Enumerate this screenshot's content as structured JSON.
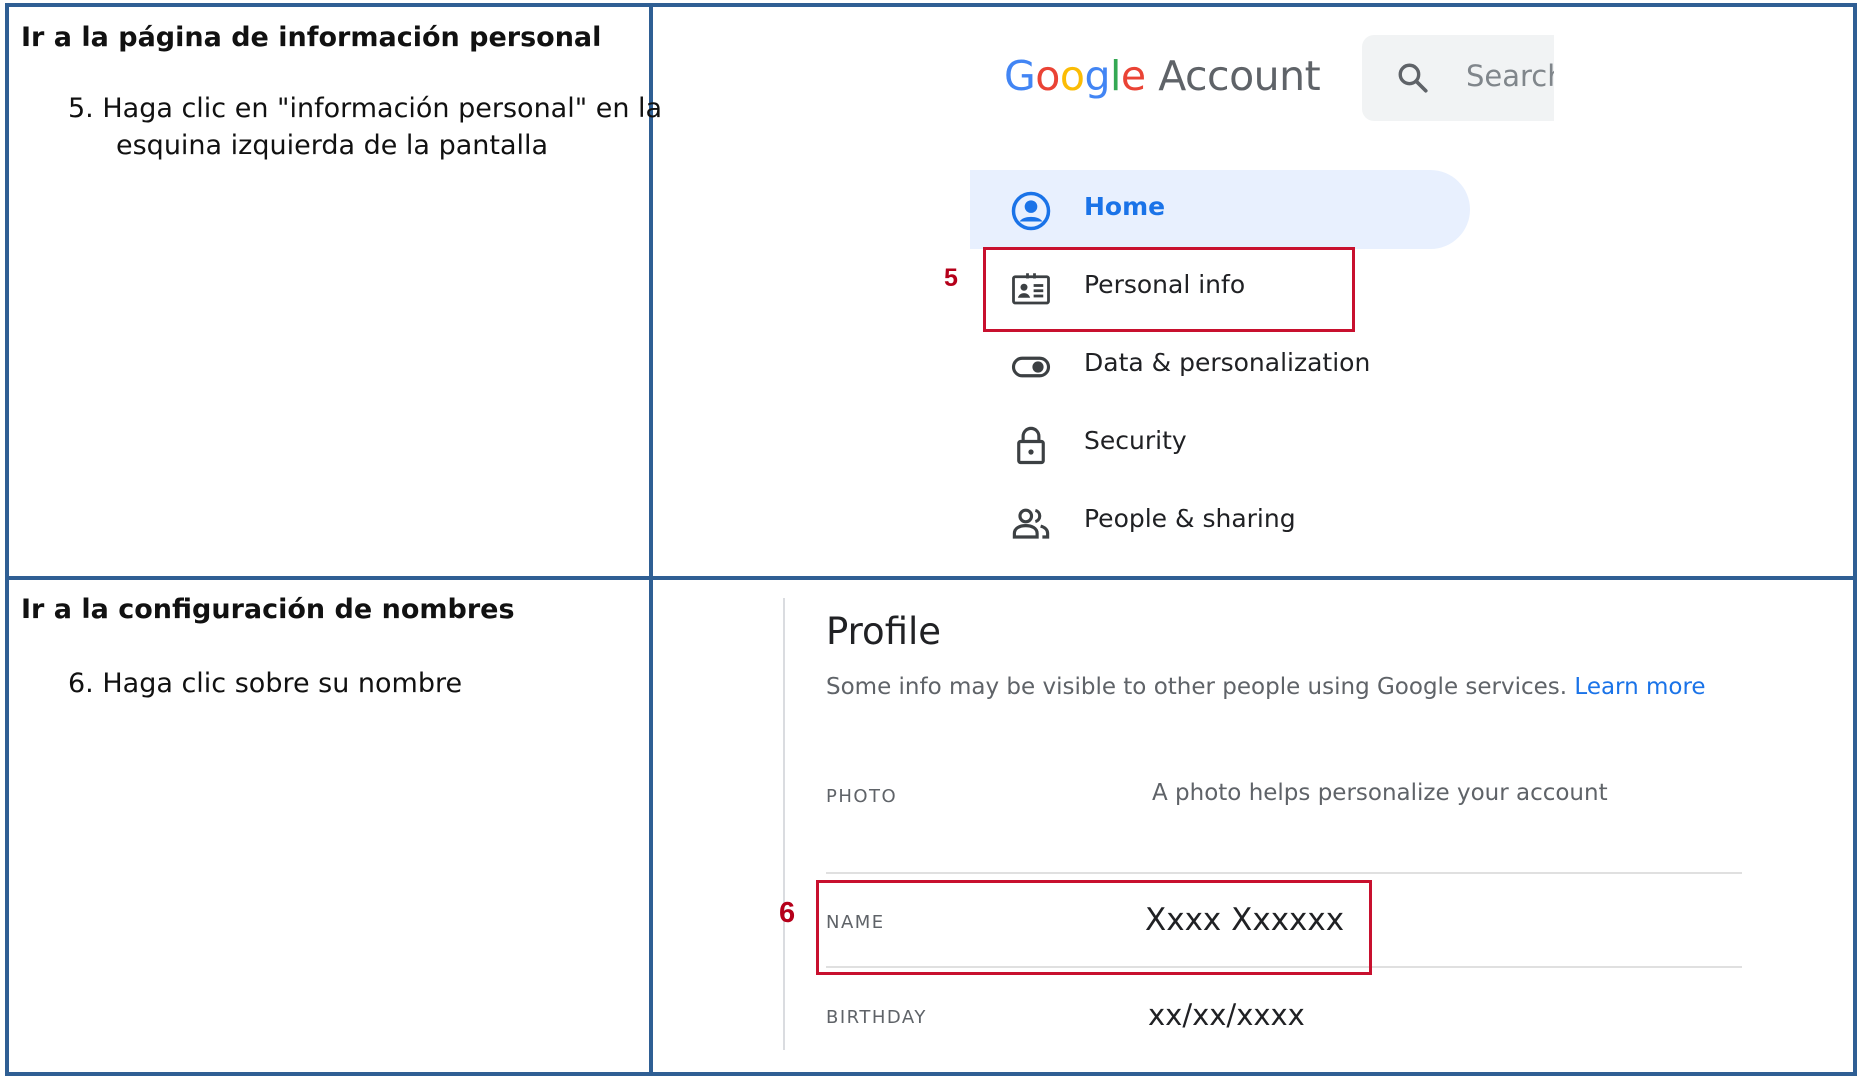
{
  "table": {
    "rows": [
      {
        "heading": "Ir a la página de información personal",
        "step_line1": "5. Haga clic en \"información personal\" en la",
        "step_line2": "esquina izquierda de la pantalla"
      },
      {
        "heading": "Ir a la configuración de nombres",
        "step_line1": "6. Haga clic sobre su nombre"
      }
    ]
  },
  "account_screen": {
    "logo": {
      "letters": [
        "G",
        "o",
        "o",
        "g",
        "l",
        "e"
      ],
      "account_word": "Account"
    },
    "search": {
      "placeholder": "Search",
      "icon": "search-icon"
    },
    "nav": [
      {
        "label": "Home",
        "icon": "account-circle-icon",
        "active": true
      },
      {
        "label": "Personal info",
        "icon": "id-card-icon",
        "active": false
      },
      {
        "label": "Data & personalization",
        "icon": "toggle-icon",
        "active": false
      },
      {
        "label": "Security",
        "icon": "lock-icon",
        "active": false
      },
      {
        "label": "People & sharing",
        "icon": "people-icon",
        "active": false
      }
    ],
    "step_marker": "5"
  },
  "profile_screen": {
    "title": "Profile",
    "subtitle": "Some info may be visible to other people using Google services.",
    "learn_more": "Learn more",
    "rows": [
      {
        "label": "PHOTO",
        "value": "A photo helps personalize your account"
      },
      {
        "label": "NAME",
        "value": "Xxxx Xxxxxx"
      },
      {
        "label": "BIRTHDAY",
        "value": "xx/xx/xxxx"
      }
    ],
    "step_marker": "6"
  },
  "colors": {
    "table_border": "#2f5f94",
    "highlight": "#c8102e",
    "active_nav_bg": "#e8f0fe",
    "link": "#1a73e8"
  }
}
